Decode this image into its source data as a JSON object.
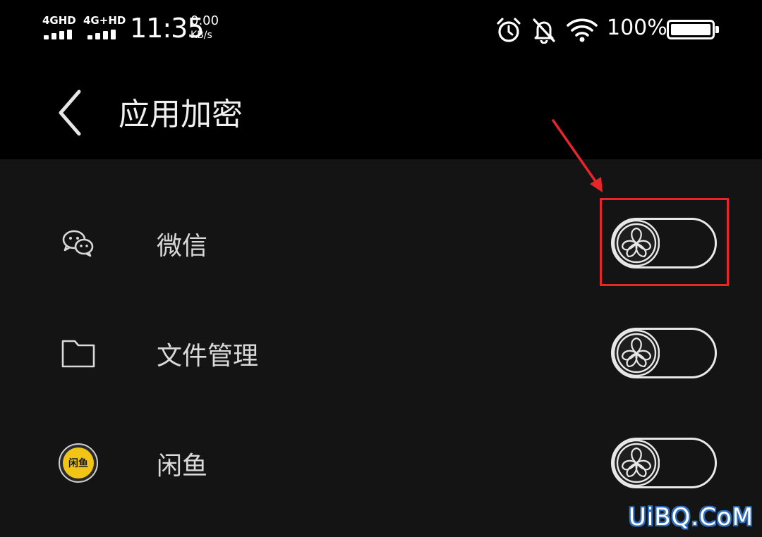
{
  "status_bar": {
    "signal1_label": "4GHD",
    "signal2_label": "4G+HD",
    "time": "11:35",
    "net_speed_value": "0.00",
    "net_speed_unit": "KB/s",
    "icons": [
      "alarm-icon",
      "mute-bell-icon",
      "wifi-icon"
    ],
    "battery_text": "100%",
    "battery_level": 1.0
  },
  "header": {
    "back_icon": "chevron-left-icon",
    "title": "应用加密"
  },
  "apps": [
    {
      "name": "微信",
      "icon": "wechat-icon",
      "enabled": false
    },
    {
      "name": "文件管理",
      "icon": "folder-icon",
      "enabled": false
    },
    {
      "name": "闲鱼",
      "icon": "xianyu-icon",
      "icon_text": "闲鱼",
      "enabled": false
    }
  ],
  "annotation": {
    "color": "#e8262a",
    "target": "微信"
  },
  "watermark": "UiBQ.CoM",
  "colors": {
    "background": "#141414",
    "topbar": "#000000",
    "text": "#d9d9d9",
    "switch_outline": "#e8e8e8",
    "highlight": "#e8262a"
  }
}
